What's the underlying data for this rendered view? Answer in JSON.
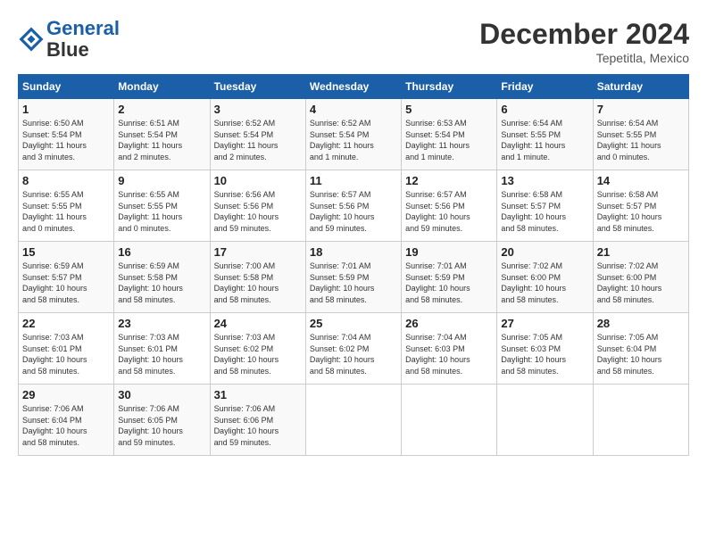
{
  "header": {
    "logo_line1": "General",
    "logo_line2": "Blue",
    "month_title": "December 2024",
    "location": "Tepetitla, Mexico"
  },
  "weekdays": [
    "Sunday",
    "Monday",
    "Tuesday",
    "Wednesday",
    "Thursday",
    "Friday",
    "Saturday"
  ],
  "weeks": [
    [
      {
        "day": "1",
        "info": "Sunrise: 6:50 AM\nSunset: 5:54 PM\nDaylight: 11 hours\nand 3 minutes."
      },
      {
        "day": "2",
        "info": "Sunrise: 6:51 AM\nSunset: 5:54 PM\nDaylight: 11 hours\nand 2 minutes."
      },
      {
        "day": "3",
        "info": "Sunrise: 6:52 AM\nSunset: 5:54 PM\nDaylight: 11 hours\nand 2 minutes."
      },
      {
        "day": "4",
        "info": "Sunrise: 6:52 AM\nSunset: 5:54 PM\nDaylight: 11 hours\nand 1 minute."
      },
      {
        "day": "5",
        "info": "Sunrise: 6:53 AM\nSunset: 5:54 PM\nDaylight: 11 hours\nand 1 minute."
      },
      {
        "day": "6",
        "info": "Sunrise: 6:54 AM\nSunset: 5:55 PM\nDaylight: 11 hours\nand 1 minute."
      },
      {
        "day": "7",
        "info": "Sunrise: 6:54 AM\nSunset: 5:55 PM\nDaylight: 11 hours\nand 0 minutes."
      }
    ],
    [
      {
        "day": "8",
        "info": "Sunrise: 6:55 AM\nSunset: 5:55 PM\nDaylight: 11 hours\nand 0 minutes."
      },
      {
        "day": "9",
        "info": "Sunrise: 6:55 AM\nSunset: 5:55 PM\nDaylight: 11 hours\nand 0 minutes."
      },
      {
        "day": "10",
        "info": "Sunrise: 6:56 AM\nSunset: 5:56 PM\nDaylight: 10 hours\nand 59 minutes."
      },
      {
        "day": "11",
        "info": "Sunrise: 6:57 AM\nSunset: 5:56 PM\nDaylight: 10 hours\nand 59 minutes."
      },
      {
        "day": "12",
        "info": "Sunrise: 6:57 AM\nSunset: 5:56 PM\nDaylight: 10 hours\nand 59 minutes."
      },
      {
        "day": "13",
        "info": "Sunrise: 6:58 AM\nSunset: 5:57 PM\nDaylight: 10 hours\nand 58 minutes."
      },
      {
        "day": "14",
        "info": "Sunrise: 6:58 AM\nSunset: 5:57 PM\nDaylight: 10 hours\nand 58 minutes."
      }
    ],
    [
      {
        "day": "15",
        "info": "Sunrise: 6:59 AM\nSunset: 5:57 PM\nDaylight: 10 hours\nand 58 minutes."
      },
      {
        "day": "16",
        "info": "Sunrise: 6:59 AM\nSunset: 5:58 PM\nDaylight: 10 hours\nand 58 minutes."
      },
      {
        "day": "17",
        "info": "Sunrise: 7:00 AM\nSunset: 5:58 PM\nDaylight: 10 hours\nand 58 minutes."
      },
      {
        "day": "18",
        "info": "Sunrise: 7:01 AM\nSunset: 5:59 PM\nDaylight: 10 hours\nand 58 minutes."
      },
      {
        "day": "19",
        "info": "Sunrise: 7:01 AM\nSunset: 5:59 PM\nDaylight: 10 hours\nand 58 minutes."
      },
      {
        "day": "20",
        "info": "Sunrise: 7:02 AM\nSunset: 6:00 PM\nDaylight: 10 hours\nand 58 minutes."
      },
      {
        "day": "21",
        "info": "Sunrise: 7:02 AM\nSunset: 6:00 PM\nDaylight: 10 hours\nand 58 minutes."
      }
    ],
    [
      {
        "day": "22",
        "info": "Sunrise: 7:03 AM\nSunset: 6:01 PM\nDaylight: 10 hours\nand 58 minutes."
      },
      {
        "day": "23",
        "info": "Sunrise: 7:03 AM\nSunset: 6:01 PM\nDaylight: 10 hours\nand 58 minutes."
      },
      {
        "day": "24",
        "info": "Sunrise: 7:03 AM\nSunset: 6:02 PM\nDaylight: 10 hours\nand 58 minutes."
      },
      {
        "day": "25",
        "info": "Sunrise: 7:04 AM\nSunset: 6:02 PM\nDaylight: 10 hours\nand 58 minutes."
      },
      {
        "day": "26",
        "info": "Sunrise: 7:04 AM\nSunset: 6:03 PM\nDaylight: 10 hours\nand 58 minutes."
      },
      {
        "day": "27",
        "info": "Sunrise: 7:05 AM\nSunset: 6:03 PM\nDaylight: 10 hours\nand 58 minutes."
      },
      {
        "day": "28",
        "info": "Sunrise: 7:05 AM\nSunset: 6:04 PM\nDaylight: 10 hours\nand 58 minutes."
      }
    ],
    [
      {
        "day": "29",
        "info": "Sunrise: 7:06 AM\nSunset: 6:04 PM\nDaylight: 10 hours\nand 58 minutes."
      },
      {
        "day": "30",
        "info": "Sunrise: 7:06 AM\nSunset: 6:05 PM\nDaylight: 10 hours\nand 59 minutes."
      },
      {
        "day": "31",
        "info": "Sunrise: 7:06 AM\nSunset: 6:06 PM\nDaylight: 10 hours\nand 59 minutes."
      },
      {
        "day": "",
        "info": ""
      },
      {
        "day": "",
        "info": ""
      },
      {
        "day": "",
        "info": ""
      },
      {
        "day": "",
        "info": ""
      }
    ]
  ]
}
